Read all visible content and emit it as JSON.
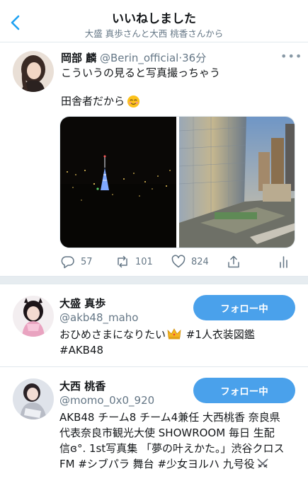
{
  "header": {
    "title": "いいねしました",
    "subtitle": "大盛 真歩さんと大西 桃香さんから",
    "back_icon": "chevron-left-icon",
    "accent": "#1da1f2"
  },
  "tweet": {
    "display_name": "岡部 麟",
    "handle": "@Berin_official",
    "dot": "·",
    "time": "36分",
    "more": "•••",
    "text_line1": "こういうの見ると写真撮っちゃう",
    "text_line2": "田舎者だから",
    "text_emoji": "smiling-face-icon",
    "media": [
      "night-tokyo-tower-photo",
      "city-skyscraper-photo"
    ],
    "actions": {
      "reply_count": "57",
      "retweet_count": "101",
      "like_count": "824"
    }
  },
  "users": [
    {
      "display_name": "大盛 真歩",
      "handle": "@akb48_maho",
      "follow_label": "フォロー中",
      "bio_part1": "おひめさまになりたい",
      "bio_part2": " #1人衣装図鑑",
      "bio_part3": "#AKB48"
    },
    {
      "display_name": "大西 桃香",
      "handle": "@momo_0x0_920",
      "follow_label": "フォロー中",
      "bio_line1": "AKB48 チーム8 チーム4兼任 大西桃香 奈良県",
      "bio_line2": "代表奈良市観光大使 SHOWROOM 毎日 生配",
      "bio_line3": "信ɞ°. 1st写真集 「夢の叶えかた。」渋谷クロス",
      "bio_line4": "FM #シブパラ 舞台 #少女ヨルハ 九号役"
    }
  ],
  "colors": {
    "follow_button": "#4aa1eb",
    "secondary_text": "#657786",
    "divider": "#e1e8ed"
  }
}
